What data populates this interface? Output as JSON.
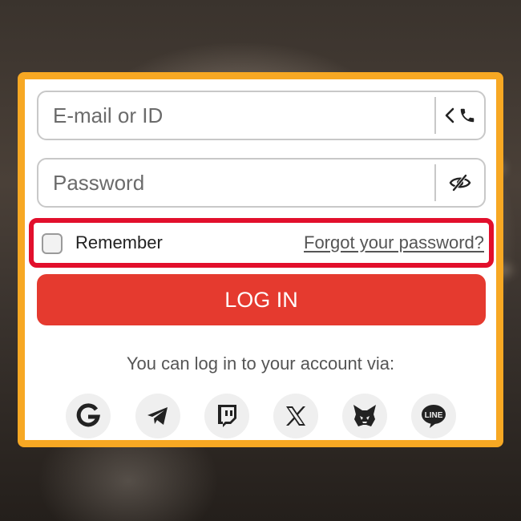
{
  "login_form": {
    "email_placeholder": "E-mail or ID",
    "password_placeholder": "Password",
    "remember_label": "Remember",
    "forgot_link": "Forgot your password?",
    "login_button": "LOG IN",
    "social_prompt": "You can log in to your account via:"
  },
  "social_providers": [
    {
      "name": "google",
      "icon": "google-icon"
    },
    {
      "name": "telegram",
      "icon": "telegram-icon"
    },
    {
      "name": "twitch",
      "icon": "twitch-icon"
    },
    {
      "name": "x",
      "icon": "x-icon"
    },
    {
      "name": "metamask",
      "icon": "metamask-fox-icon"
    },
    {
      "name": "line",
      "icon": "line-icon"
    }
  ],
  "colors": {
    "frame": "#f7a823",
    "highlight": "#e20f2c",
    "login_button": "#e53a2f",
    "input_border": "#c8c8c8"
  }
}
